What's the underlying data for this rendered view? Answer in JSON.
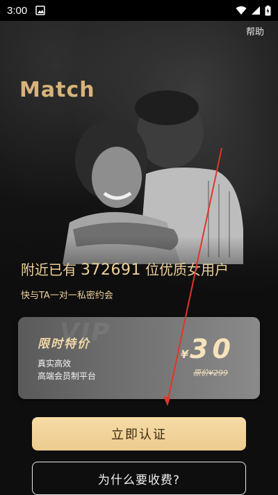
{
  "status_bar": {
    "time": "3:00",
    "icons": [
      "image-icon",
      "wifi-icon",
      "signal-icon",
      "battery-charging-icon"
    ]
  },
  "header": {
    "help_label": "帮助",
    "brand": "Match"
  },
  "hero": {
    "headline_prefix": "附近已有",
    "user_count": "372691",
    "headline_suffix": "位优质女用户",
    "subline": "快与TA一对一私密约会"
  },
  "offer": {
    "watermark": "VIP",
    "title": "限时特价",
    "line1": "真实高效",
    "line2": "高端会员制平台",
    "currency": "¥",
    "price": "30",
    "original_price": "原价¥299"
  },
  "actions": {
    "primary_label": "立即认证",
    "secondary_label": "为什么要收费?"
  },
  "colors": {
    "accent_gold": "#f0d29b",
    "button_gold": "#f3d39a",
    "annotation_red": "#e0352b"
  }
}
